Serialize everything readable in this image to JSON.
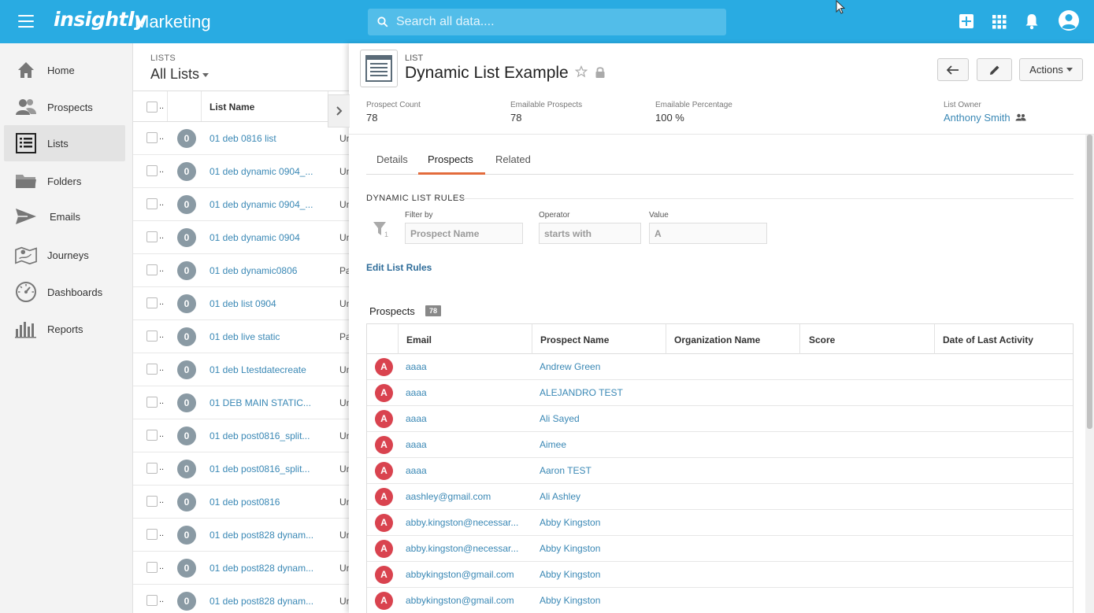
{
  "topbar": {
    "brand": "insightly",
    "app_title": "Marketing",
    "search_placeholder": "Search all data...."
  },
  "sidebar": {
    "items": [
      {
        "label": "Home",
        "icon": "home-icon"
      },
      {
        "label": "Prospects",
        "icon": "prospects-icon"
      },
      {
        "label": "Lists",
        "icon": "lists-icon"
      },
      {
        "label": "Folders",
        "icon": "folder-icon"
      },
      {
        "label": "Emails",
        "icon": "send-icon"
      },
      {
        "label": "Journeys",
        "icon": "map-icon"
      },
      {
        "label": "Dashboards",
        "icon": "gauge-icon"
      },
      {
        "label": "Reports",
        "icon": "bar-chart-icon"
      }
    ],
    "active_index": 2
  },
  "lists": {
    "section_label": "LISTS",
    "view_title": "All Lists",
    "header_dots": "..",
    "column_name": "List Name",
    "rows": [
      {
        "count": "0",
        "name": "01 deb 0816 list",
        "status": "Un"
      },
      {
        "count": "0",
        "name": "01 deb dynamic 0904_...",
        "status": "Un"
      },
      {
        "count": "0",
        "name": "01 deb dynamic 0904_...",
        "status": "Un"
      },
      {
        "count": "0",
        "name": "01 deb dynamic 0904",
        "status": "Un"
      },
      {
        "count": "0",
        "name": "01 deb dynamic0806",
        "status": "Pa"
      },
      {
        "count": "0",
        "name": "01 deb list 0904",
        "status": "Un"
      },
      {
        "count": "0",
        "name": "01 deb live static",
        "status": "Pa"
      },
      {
        "count": "0",
        "name": "01 deb Ltestdatecreate",
        "status": "Un"
      },
      {
        "count": "0",
        "name": "01 DEB MAIN STATIC...",
        "status": "Un"
      },
      {
        "count": "0",
        "name": "01 deb post0816_split...",
        "status": "Un"
      },
      {
        "count": "0",
        "name": "01 deb post0816_split...",
        "status": "Un"
      },
      {
        "count": "0",
        "name": "01 deb post0816",
        "status": "Un"
      },
      {
        "count": "0",
        "name": "01 deb post828 dynam...",
        "status": "Un"
      },
      {
        "count": "0",
        "name": "01 deb post828 dynam...",
        "status": "Un"
      },
      {
        "count": "0",
        "name": "01 deb post828 dynam...",
        "status": "Un"
      }
    ]
  },
  "record": {
    "type_label": "LIST",
    "title": "Dynamic List Example",
    "actions_label": "Actions",
    "metrics": [
      {
        "label": "Prospect Count",
        "value": "78"
      },
      {
        "label": "Emailable Prospects",
        "value": "78"
      },
      {
        "label": "Emailable Percentage",
        "value": "100 %"
      }
    ],
    "owner": {
      "label": "List Owner",
      "name": "Anthony Smith"
    },
    "tabs": [
      "Details",
      "Prospects",
      "Related"
    ],
    "active_tab": 1
  },
  "rules": {
    "title": "DYNAMIC LIST RULES",
    "filter_count": "1",
    "filter_label": "Filter by",
    "filter_value": "Prospect Name",
    "operator_label": "Operator",
    "operator_value": "starts with",
    "value_label": "Value",
    "value_value": "A",
    "edit_link": "Edit List Rules"
  },
  "prospects": {
    "title": "Prospects",
    "count": "78",
    "columns": [
      "Email",
      "Prospect Name",
      "Organization Name",
      "Score",
      "Date of Last Activity"
    ],
    "rows": [
      {
        "initial": "A",
        "email": "aaaa",
        "name": "Andrew Green"
      },
      {
        "initial": "A",
        "email": "aaaa",
        "name": "ALEJANDRO TEST"
      },
      {
        "initial": "A",
        "email": "aaaa",
        "name": "Ali Sayed"
      },
      {
        "initial": "A",
        "email": "aaaa",
        "name": "Aimee"
      },
      {
        "initial": "A",
        "email": "aaaa",
        "name": "Aaron TEST"
      },
      {
        "initial": "A",
        "email": "aashley@gmail.com",
        "name": "Ali Ashley"
      },
      {
        "initial": "A",
        "email": "abby.kingston@necessar...",
        "name": "Abby Kingston"
      },
      {
        "initial": "A",
        "email": "abby.kingston@necessar...",
        "name": "Abby Kingston"
      },
      {
        "initial": "A",
        "email": "abbykingston@gmail.com",
        "name": "Abby Kingston"
      },
      {
        "initial": "A",
        "email": "abbykingston@gmail.com",
        "name": "Abby Kingston"
      }
    ]
  },
  "colors": {
    "topbar": "#29abe2",
    "link": "#3a88b5",
    "active_tab": "#e36b3c",
    "avatar": "#d9434f"
  }
}
